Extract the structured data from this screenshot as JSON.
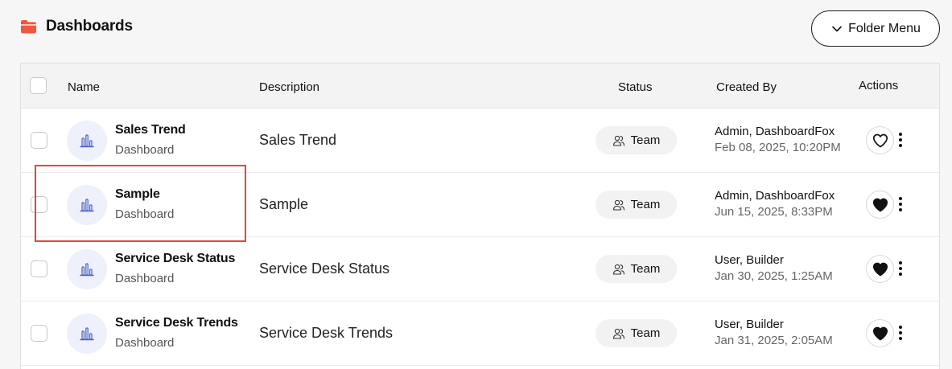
{
  "header": {
    "title": "Dashboards",
    "folder_icon_color": "#f0573f",
    "folder_menu_label": "Folder Menu"
  },
  "table": {
    "columns": {
      "name": "Name",
      "description": "Description",
      "status": "Status",
      "created_by": "Created By",
      "actions": "Actions"
    },
    "rows": [
      {
        "name": "Sales Trend",
        "type": "Dashboard",
        "description": "Sales Trend",
        "status": "Team",
        "created_by": "Admin, DashboardFox",
        "created_date": "Feb 08, 2025, 10:20PM",
        "favorite": false
      },
      {
        "name": "Sample",
        "type": "Dashboard",
        "description": "Sample",
        "status": "Team",
        "created_by": "Admin, DashboardFox",
        "created_date": "Jun 15, 2025, 8:33PM",
        "favorite": true
      },
      {
        "name": "Service Desk Status",
        "type": "Dashboard",
        "description": "Service Desk Status",
        "status": "Team",
        "created_by": "User, Builder",
        "created_date": "Jan 30, 2025, 1:25AM",
        "favorite": true
      },
      {
        "name": "Service Desk Trends",
        "type": "Dashboard",
        "description": "Service Desk Trends",
        "status": "Team",
        "created_by": "User, Builder",
        "created_date": "Jan 31, 2025, 2:05AM",
        "favorite": true
      }
    ]
  },
  "icons": {
    "folder": "folder-icon",
    "chevron": "chevron-down-icon",
    "avatar": "bar-chart-icon",
    "status": "users-icon",
    "favorite": "heart-icon",
    "more": "more-vertical-icon"
  },
  "colors": {
    "accent": "#f0573f",
    "avatar_bg": "#eef0fb",
    "chart_icon": "#4a62c9",
    "highlight": "#e0473f"
  }
}
